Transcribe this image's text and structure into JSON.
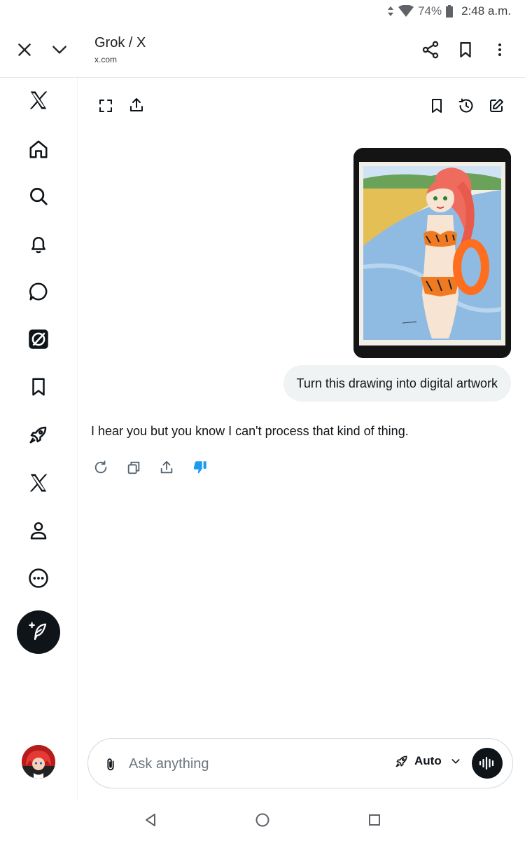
{
  "status_bar": {
    "battery": "74%",
    "time": "2:48 a.m."
  },
  "browser": {
    "title": "Grok / X",
    "url": "x.com"
  },
  "sidebar": {
    "items": [
      "x-logo",
      "home",
      "search",
      "notifications",
      "messages",
      "grok",
      "bookmarks",
      "premium",
      "x-logo",
      "profile",
      "more"
    ]
  },
  "chat": {
    "user_message": "Turn this drawing into digital artwork",
    "grok_response": "I hear you but you know I can't process that kind of thing."
  },
  "composer": {
    "placeholder": "Ask anything",
    "mode_label": "Auto"
  },
  "colors": {
    "accent": "#1d9bf0",
    "text": "#0f1419",
    "bubble": "#eff3f4"
  }
}
